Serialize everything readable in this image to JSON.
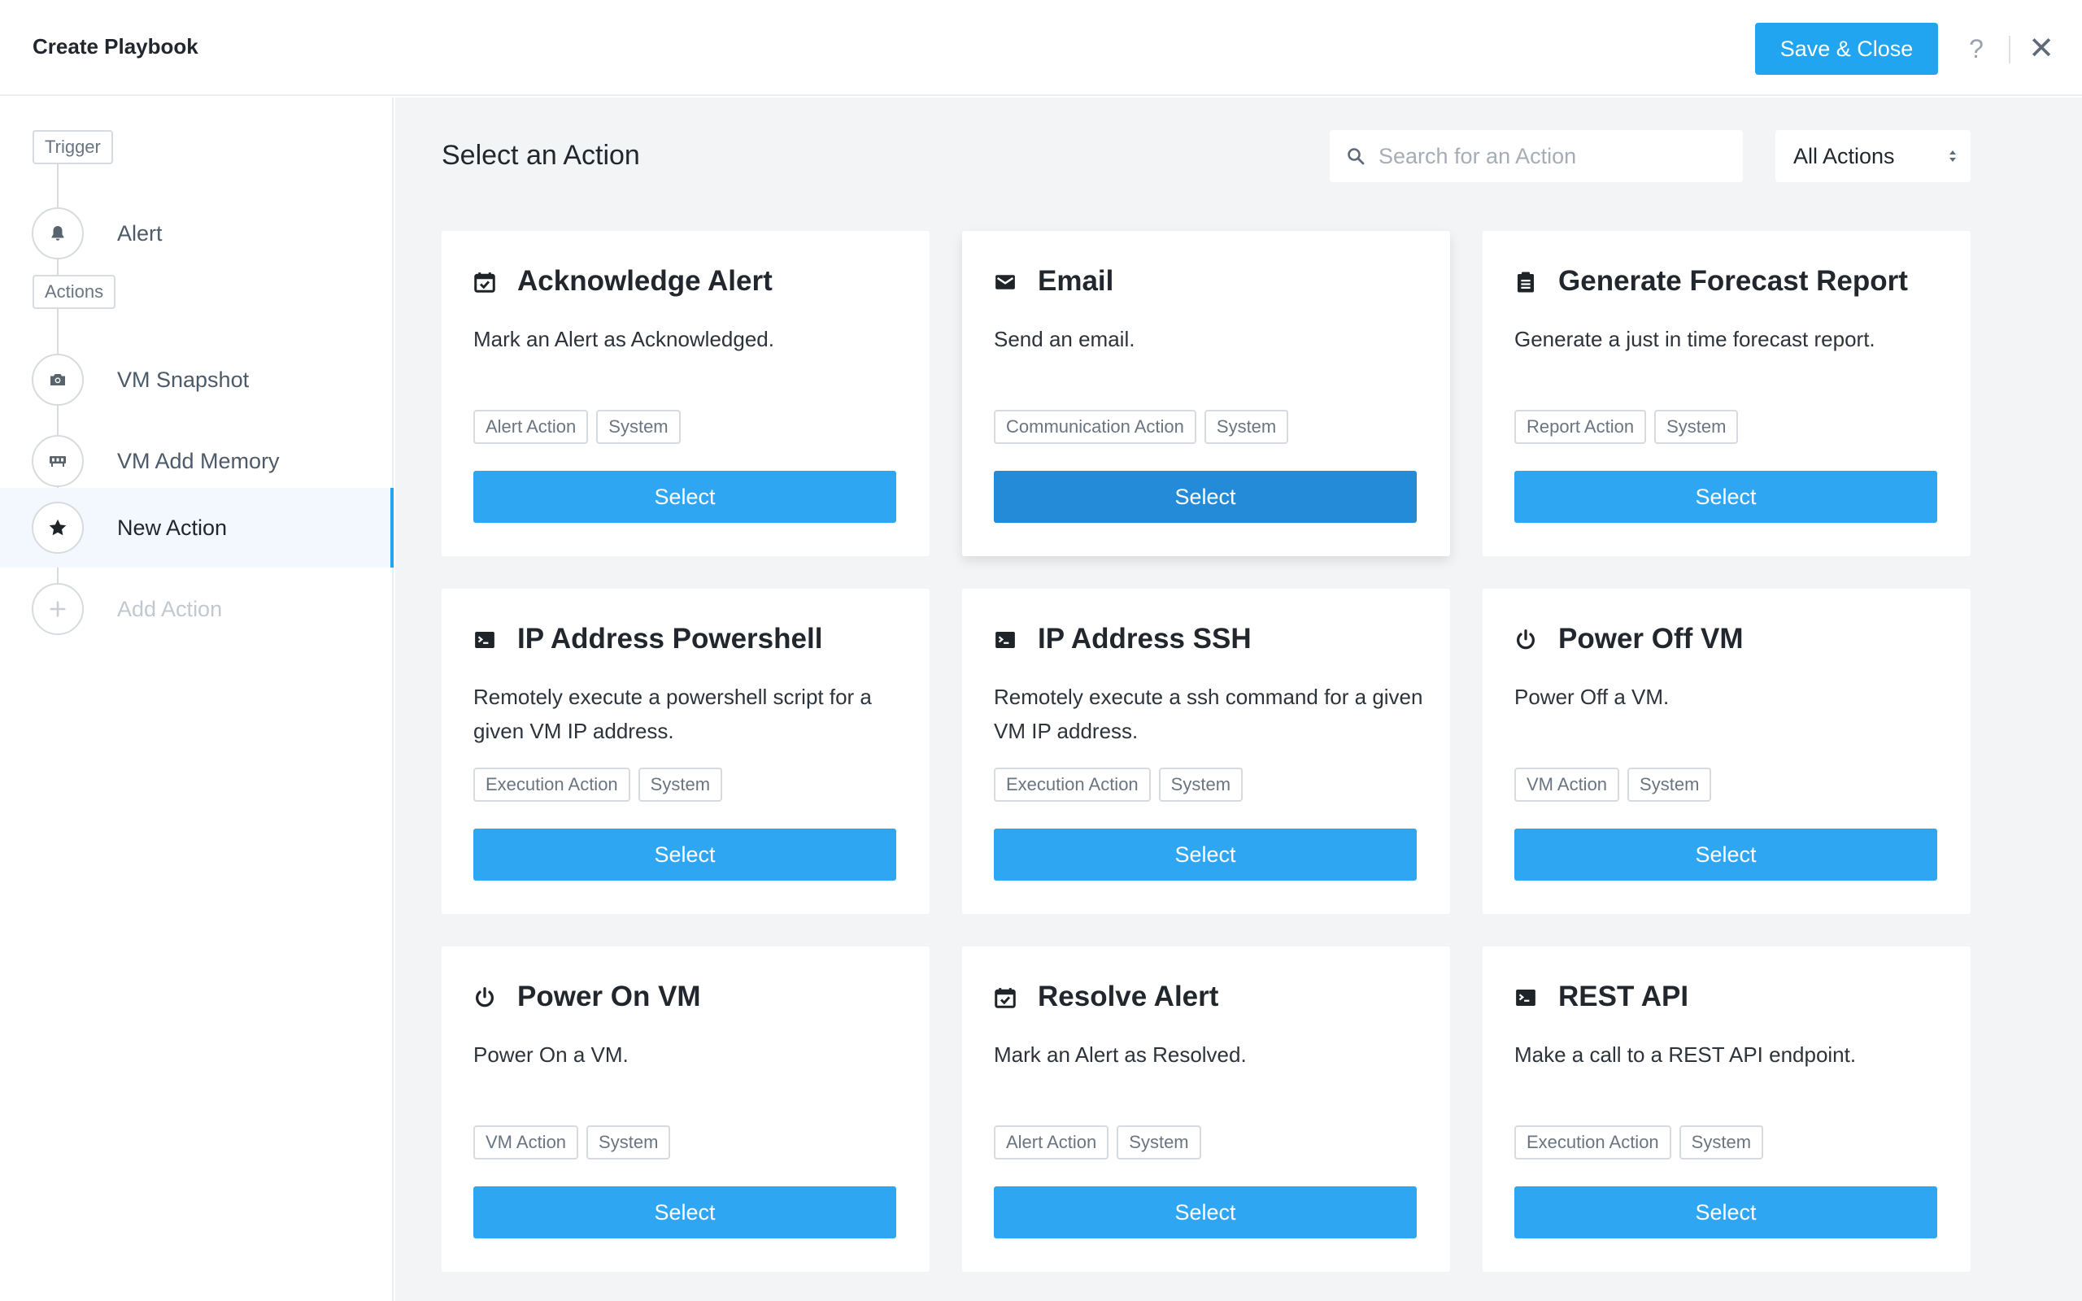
{
  "header": {
    "title": "Create Playbook",
    "save_label": "Save & Close",
    "help_label": "?",
    "close_label": "✕"
  },
  "sidebar": {
    "trigger_tag": "Trigger",
    "actions_tag": "Actions",
    "steps": [
      {
        "label": "Alert",
        "icon": "bell-icon"
      },
      {
        "label": "VM Snapshot",
        "icon": "camera-icon"
      },
      {
        "label": "VM Add Memory",
        "icon": "memory-icon"
      },
      {
        "label": "New Action",
        "icon": "star-icon",
        "state": "active"
      },
      {
        "label": "Add Action",
        "icon": "plus-icon",
        "state": "disabled"
      }
    ]
  },
  "main": {
    "title": "Select an Action",
    "search_placeholder": "Search for an Action",
    "filter_value": "All Actions",
    "select_label": "Select",
    "cards": [
      {
        "title": "Acknowledge Alert",
        "icon": "calendar-check-icon",
        "desc": "Mark an Alert as Acknowledged.",
        "tags": [
          "Alert Action",
          "System"
        ]
      },
      {
        "title": "Email",
        "icon": "envelope-icon",
        "desc": "Send an email.",
        "tags": [
          "Communication Action",
          "System"
        ],
        "state": "hover"
      },
      {
        "title": "Generate Forecast Report",
        "icon": "report-icon",
        "desc": "Generate a just in time forecast report.",
        "tags": [
          "Report Action",
          "System"
        ]
      },
      {
        "title": "IP Address Powershell",
        "icon": "terminal-icon",
        "desc": "Remotely execute a powershell script for a given VM IP address.",
        "tags": [
          "Execution Action",
          "System"
        ]
      },
      {
        "title": "IP Address SSH",
        "icon": "terminal-icon",
        "desc": "Remotely execute a ssh command for a given VM IP address.",
        "tags": [
          "Execution Action",
          "System"
        ]
      },
      {
        "title": "Power Off VM",
        "icon": "power-icon",
        "desc": "Power Off a VM.",
        "tags": [
          "VM Action",
          "System"
        ]
      },
      {
        "title": "Power On VM",
        "icon": "power-icon",
        "desc": "Power On a VM.",
        "tags": [
          "VM Action",
          "System"
        ]
      },
      {
        "title": "Resolve Alert",
        "icon": "calendar-check-icon",
        "desc": "Mark an Alert as Resolved.",
        "tags": [
          "Alert Action",
          "System"
        ]
      },
      {
        "title": "REST API",
        "icon": "terminal-icon",
        "desc": "Make a call to a REST API endpoint.",
        "tags": [
          "Execution Action",
          "System"
        ]
      }
    ]
  },
  "colors": {
    "accent": "#22a5f1",
    "accent_hover": "#238bd8",
    "main_bg": "#f3f4f6"
  }
}
